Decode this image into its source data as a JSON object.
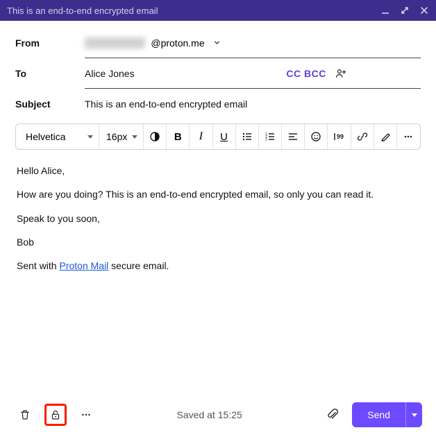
{
  "titlebar": {
    "title": "This is an end-to-end encrypted email"
  },
  "labels": {
    "from": "From",
    "to": "To",
    "subject": "Subject"
  },
  "from": {
    "masked": "████████",
    "domain": "@proton.me"
  },
  "to": {
    "value": "Alice Jones",
    "ccbcc": "CC BCC"
  },
  "subject": {
    "value": "This is an end-to-end encrypted email"
  },
  "toolbar": {
    "font": "Helvetica",
    "size": "16px"
  },
  "body": {
    "p1": "Hello Alice,",
    "p2": "How are you doing? This is an end-to-end encrypted email, so only you can read it.",
    "p3": "Speak to you soon,",
    "p4": "Bob",
    "sig_pre": "Sent with ",
    "sig_link": "Proton Mail",
    "sig_post": " secure email."
  },
  "footer": {
    "saved": "Saved at 15:25",
    "send": "Send"
  }
}
